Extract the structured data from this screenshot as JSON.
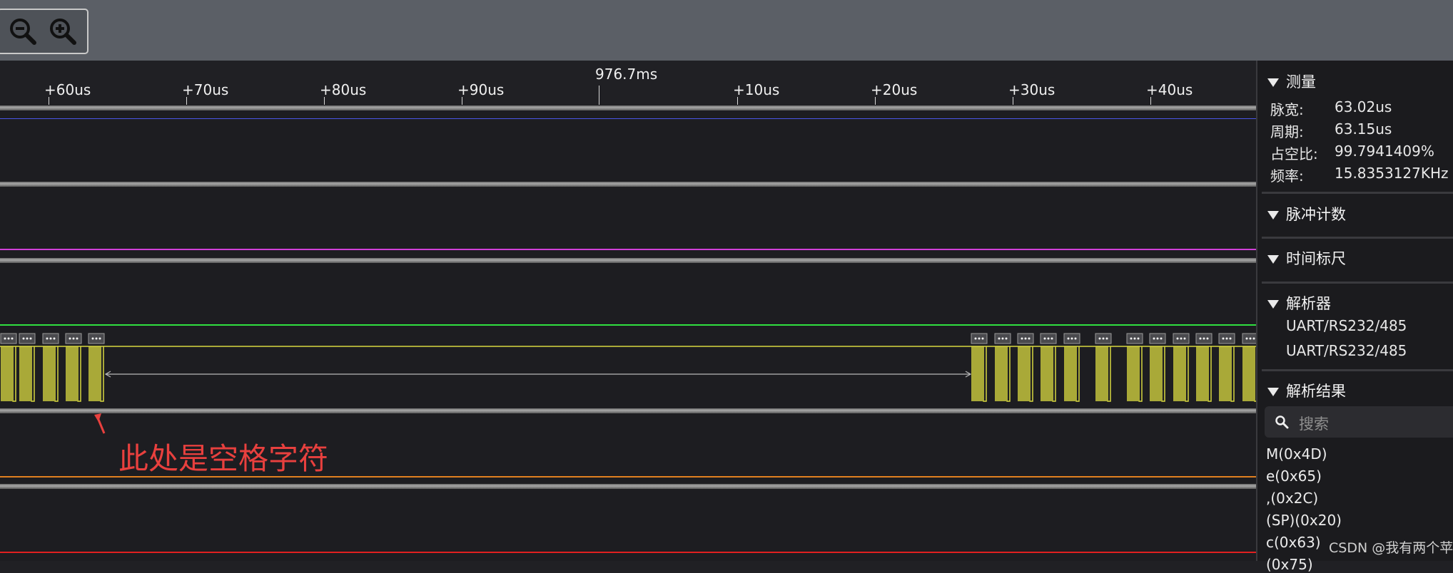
{
  "toolbar": {
    "zoom_out_icon": "zoom-out-magnifier",
    "zoom_in_icon": "zoom-in-magnifier"
  },
  "ruler": {
    "center_label": "976.7ms",
    "ticks": [
      "+60us",
      "+70us",
      "+80us",
      "+90us",
      "+10us",
      "+20us",
      "+30us",
      "+40us"
    ]
  },
  "annotation": {
    "text": "此处是空格字符",
    "color": "#e8403e"
  },
  "colors": {
    "channel_blue": "#4a55e8",
    "channel_magenta": "#d040d8",
    "channel_green": "#30e040",
    "uart_yellow": "#d8d840",
    "channel_orange": "#e08020",
    "channel_red": "#e02020"
  },
  "sidebar": {
    "measure": {
      "title": "测量",
      "rows": [
        {
          "label": "脉宽:",
          "value": "63.02us"
        },
        {
          "label": "周期:",
          "value": "63.15us"
        },
        {
          "label": "占空比:",
          "value": "99.7941409%"
        },
        {
          "label": "频率:",
          "value": "15.8353127KHz"
        }
      ]
    },
    "pulse_count": {
      "title": "脉冲计数"
    },
    "time_ruler": {
      "title": "时间标尺"
    },
    "parser": {
      "title": "解析器",
      "items": [
        "UART/RS232/485",
        "UART/RS232/485"
      ]
    },
    "results": {
      "title": "解析结果",
      "search_placeholder": "搜索",
      "items": [
        "M(0x4D)",
        "e(0x65)",
        ",(0x2C)",
        "(SP)(0x20)",
        "c(0x63)",
        "(0x75)"
      ]
    }
  },
  "watermark": "CSDN @我有两个苹果"
}
